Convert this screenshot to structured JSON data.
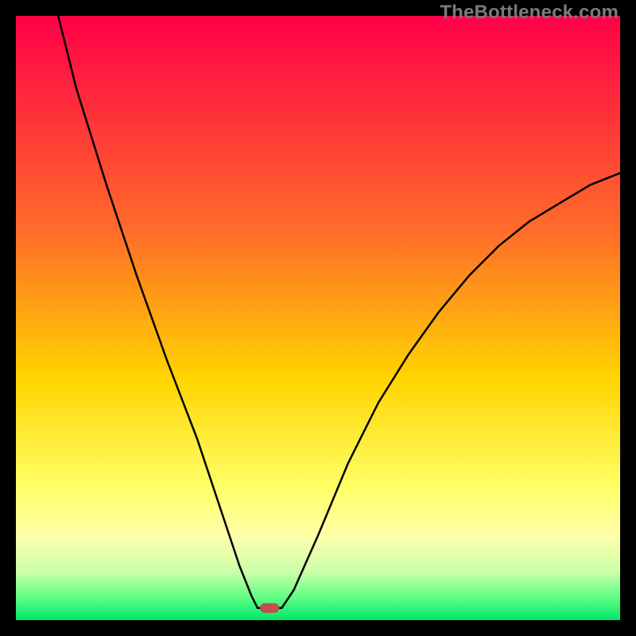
{
  "watermark": "TheBottleneck.com",
  "chart_data": {
    "type": "line",
    "title": "",
    "xlabel": "",
    "ylabel": "",
    "xlim": [
      0,
      100
    ],
    "ylim": [
      0,
      100
    ],
    "background_gradient_stops": [
      {
        "y": 0,
        "color": "#ff0048"
      },
      {
        "y": 35,
        "color": "#ff6a2a"
      },
      {
        "y": 60,
        "color": "#ffd400"
      },
      {
        "y": 78,
        "color": "#ffff66"
      },
      {
        "y": 86,
        "color": "#ffffaa"
      },
      {
        "y": 92,
        "color": "#ccffaa"
      },
      {
        "y": 96,
        "color": "#66ff88"
      },
      {
        "y": 100,
        "color": "#00e868"
      }
    ],
    "curve_points_left": [
      {
        "x": 7,
        "y": 100
      },
      {
        "x": 10,
        "y": 88
      },
      {
        "x": 15,
        "y": 72
      },
      {
        "x": 20,
        "y": 57
      },
      {
        "x": 25,
        "y": 43
      },
      {
        "x": 30,
        "y": 30
      },
      {
        "x": 34,
        "y": 18
      },
      {
        "x": 37,
        "y": 9
      },
      {
        "x": 39,
        "y": 4
      },
      {
        "x": 40,
        "y": 2
      }
    ],
    "curve_points_right": [
      {
        "x": 44,
        "y": 2
      },
      {
        "x": 46,
        "y": 5
      },
      {
        "x": 50,
        "y": 14
      },
      {
        "x": 55,
        "y": 26
      },
      {
        "x": 60,
        "y": 36
      },
      {
        "x": 65,
        "y": 44
      },
      {
        "x": 70,
        "y": 51
      },
      {
        "x": 75,
        "y": 57
      },
      {
        "x": 80,
        "y": 62
      },
      {
        "x": 85,
        "y": 66
      },
      {
        "x": 90,
        "y": 69
      },
      {
        "x": 95,
        "y": 72
      },
      {
        "x": 100,
        "y": 74
      }
    ],
    "minimum_marker": {
      "x": 42,
      "y": 2,
      "w": 3.2,
      "h": 1.6,
      "color": "#c0504d"
    },
    "note": "x and y are percentages of plotting area; y measured from bottom (0) to top (100)."
  }
}
